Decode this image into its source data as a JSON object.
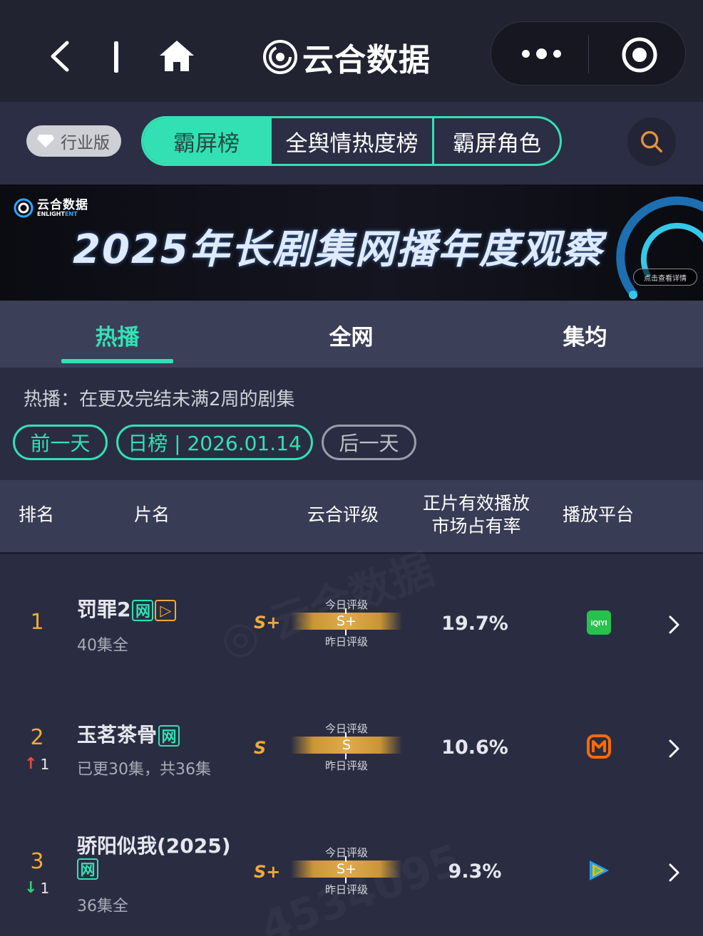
{
  "nav": {
    "brand": "云合数据",
    "icons": [
      "back-icon",
      "home-icon",
      "more-icon",
      "target-icon",
      "search-icon"
    ]
  },
  "category": {
    "edition": "行业版",
    "segments": [
      "霸屏榜",
      "全舆情热度榜",
      "霸屏角色"
    ],
    "active": "霸屏榜"
  },
  "banner": {
    "logo_cn": "云合数据",
    "logo_en_a": "ENLIGHT",
    "logo_en_b": "ENT",
    "title": "2025年长剧集网播年度观察",
    "button": "点击查看详情"
  },
  "tabs": [
    "热播",
    "全网",
    "集均"
  ],
  "active_tab": "热播",
  "info": {
    "description": "热播：在更及完结未满2周的剧集",
    "prev_day": "前一天",
    "date_label": "日榜 | 2026.01.14",
    "next_day": "后一天"
  },
  "table": {
    "headers": {
      "rank": "排名",
      "name": "片名",
      "grade": "云合评级",
      "share_line1": "正片有效播放",
      "share_line2": "市场占有率",
      "platform": "播放平台"
    },
    "grade_today_label": "今日评级",
    "grade_yesterday_label": "昨日评级",
    "rows": [
      {
        "rank": "1",
        "trend_dir": "",
        "trend_val": "",
        "title": "罚罪2",
        "badges": [
          "网",
          "▷"
        ],
        "subtitle": "40集全",
        "grade": "S+",
        "grade_bar": "S+",
        "share": "19.7%",
        "platform": "iqiyi-icon",
        "platform_text": "iQIYI",
        "platform_color": "#27c24c"
      },
      {
        "rank": "2",
        "trend_dir": "up",
        "trend_val": "1",
        "title": "玉茗茶骨",
        "badges": [
          "网"
        ],
        "subtitle": "已更30集，共36集",
        "grade": "S",
        "grade_bar": "S",
        "share": "10.6%",
        "platform": "mango-tv-icon",
        "platform_text": "",
        "platform_color": "#ff6a00"
      },
      {
        "rank": "3",
        "trend_dir": "down",
        "trend_val": "1",
        "title": "骄阳似我(2025)",
        "badges": [
          "网"
        ],
        "subtitle": "36集全",
        "grade": "S+",
        "grade_bar": "S+",
        "share": "9.3%",
        "platform": "tencent-video-icon",
        "platform_text": "",
        "platform_color": "#1aa3ff"
      }
    ]
  },
  "colors": {
    "accent": "#33e0b4",
    "rank": "#f0a93b",
    "up": "#f04a3a",
    "down": "#2fd07a"
  }
}
